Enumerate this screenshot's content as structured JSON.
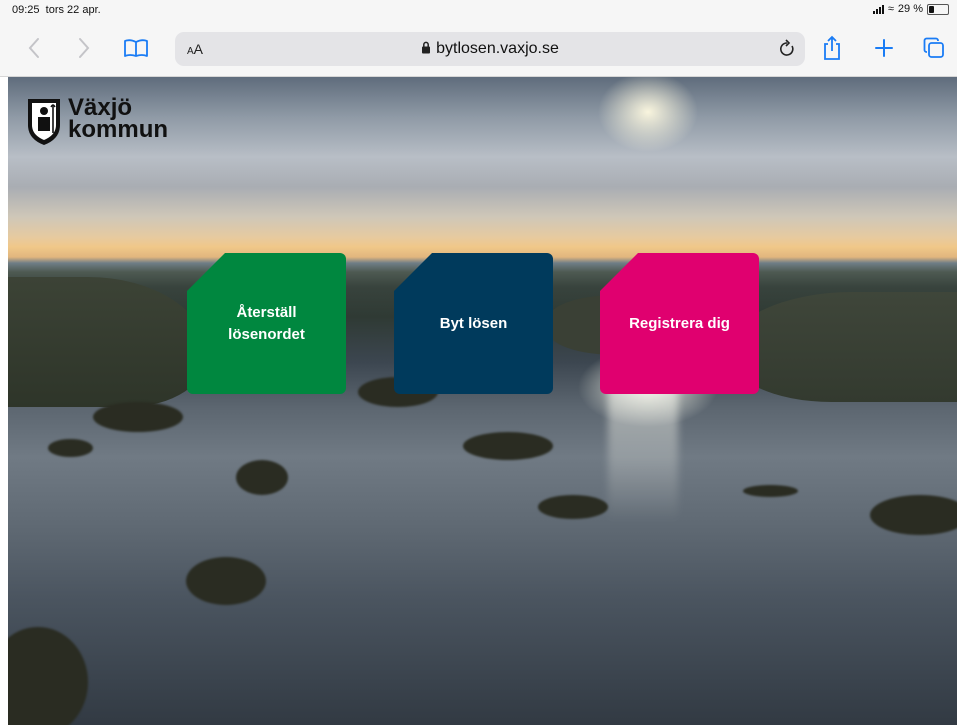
{
  "status_bar": {
    "time": "09:25",
    "date": "tors 22 apr.",
    "battery": "29 %",
    "battery_level": 0.29
  },
  "browser": {
    "text_size_label": "AA",
    "url": "bytlosen.vaxjo.se",
    "icons": [
      "back-icon",
      "forward-icon",
      "bookmarks-icon",
      "lock-icon",
      "reload-icon",
      "share-icon",
      "new-tab-icon",
      "tabs-icon"
    ]
  },
  "logo": {
    "line1": "Växjö",
    "line2": "kommun"
  },
  "tiles": [
    {
      "label": "Återställ lösenordet",
      "color": "#00873f"
    },
    {
      "label": "Byt lösen",
      "color": "#003a5c"
    },
    {
      "label": "Registrera dig",
      "color": "#e0006f"
    }
  ]
}
